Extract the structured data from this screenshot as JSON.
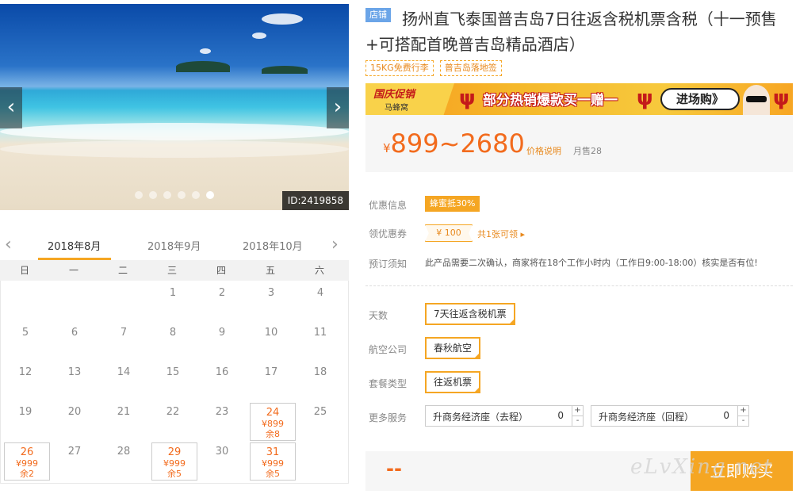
{
  "gallery": {
    "id_label": "ID:2419858",
    "prev": "‹",
    "next": "›",
    "dot_count": 6,
    "active_dot": 5
  },
  "calendar": {
    "prev": "‹",
    "next": "›",
    "months": [
      "2018年8月",
      "2018年9月",
      "2018年10月"
    ],
    "active_month": 0,
    "weekdays": [
      "日",
      "一",
      "二",
      "三",
      "四",
      "五",
      "六"
    ],
    "weeks": [
      [
        null,
        null,
        null,
        {
          "d": "1"
        },
        {
          "d": "2"
        },
        {
          "d": "3"
        },
        {
          "d": "4"
        }
      ],
      [
        {
          "d": "5"
        },
        {
          "d": "6"
        },
        {
          "d": "7"
        },
        {
          "d": "8"
        },
        {
          "d": "9"
        },
        {
          "d": "10"
        },
        {
          "d": "11"
        }
      ],
      [
        {
          "d": "12"
        },
        {
          "d": "13"
        },
        {
          "d": "14"
        },
        {
          "d": "15"
        },
        {
          "d": "16"
        },
        {
          "d": "17"
        },
        {
          "d": "18"
        }
      ],
      [
        {
          "d": "19"
        },
        {
          "d": "20"
        },
        {
          "d": "21"
        },
        {
          "d": "22"
        },
        {
          "d": "23"
        },
        {
          "d": "24",
          "p": "¥899",
          "r": "余8"
        },
        {
          "d": "25"
        }
      ],
      [
        {
          "d": "26",
          "p": "¥999",
          "r": "余2"
        },
        {
          "d": "27"
        },
        {
          "d": "28"
        },
        {
          "d": "29",
          "p": "¥999",
          "r": "余5"
        },
        {
          "d": "30"
        },
        {
          "d": "31",
          "p": "¥999",
          "r": "余5"
        },
        null
      ]
    ]
  },
  "product": {
    "shop_tag": "店铺",
    "title": "扬州直飞泰国普吉岛7日往返含税机票含税（十一预售+可搭配首晚普吉岛精品酒店）",
    "tags": [
      "15KG免费行李",
      "普吉岛落地签"
    ]
  },
  "banner": {
    "brand": "国庆促销",
    "sub": "马蜂窝",
    "text": "部分热销爆款买一赠一",
    "enter": "进场购》",
    "cactus": "ψ"
  },
  "price": {
    "currency": "¥",
    "range": "899~2680",
    "explain": "价格说明",
    "monthly": "月售28"
  },
  "info": {
    "promo_label": "优惠信息",
    "promo_badge": "蜂蜜抵30%",
    "coupon_label": "领优惠券",
    "coupon_value": "¥ 100",
    "coupon_link": "共1张可领 ▸",
    "booking_label": "预订须知",
    "booking_note": "此产品需要二次确认，商家将在18个工作小时内（工作日9:00-18:00）核实是否有位!"
  },
  "options": {
    "days_label": "天数",
    "days_value": "7天往返含税机票",
    "airline_label": "航空公司",
    "airline_value": "春秋航空",
    "package_label": "套餐类型",
    "package_value": "往返机票",
    "more_label": "更多服务",
    "upgrade_out_label": "升商务经济座（去程）",
    "upgrade_out_value": "0",
    "upgrade_back_label": "升商务经济座（回程）",
    "upgrade_back_value": "0",
    "plus": "+",
    "minus": "-",
    "check": "✔"
  },
  "bottom": {
    "total": "--",
    "buy": "立即购买",
    "watermark": "eLvXing.net"
  }
}
